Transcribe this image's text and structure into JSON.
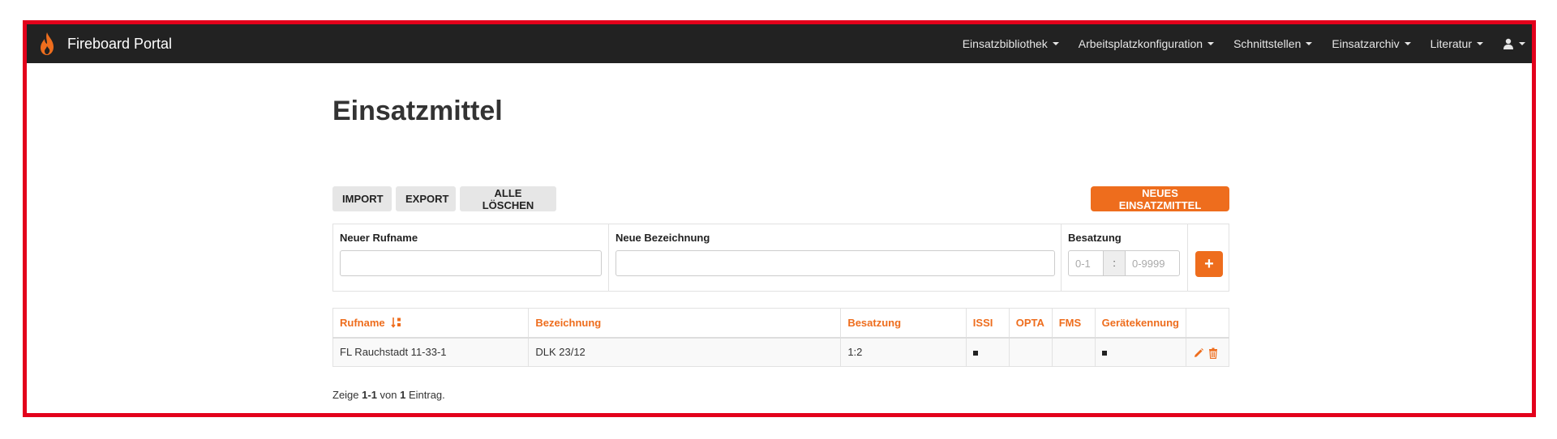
{
  "app": {
    "brand": "Fireboard Portal"
  },
  "nav": {
    "items": [
      {
        "label": "Einsatzbibliothek"
      },
      {
        "label": "Arbeitsplatzkonfiguration"
      },
      {
        "label": "Schnittstellen"
      },
      {
        "label": "Einsatzarchiv"
      },
      {
        "label": "Literatur"
      }
    ]
  },
  "page": {
    "title": "Einsatzmittel"
  },
  "toolbar": {
    "import_label": "IMPORT",
    "export_label": "EXPORT",
    "delete_all_label": "ALLE LÖSCHEN",
    "new_label": "NEUES EINSATZMITTEL"
  },
  "form": {
    "rufname_label": "Neuer Rufname",
    "rufname_value": "",
    "bezeichnung_label": "Neue Bezeichnung",
    "bezeichnung_value": "",
    "besatzung_label": "Besatzung",
    "besatzung_a_placeholder": "0-1",
    "besatzung_separator": ":",
    "besatzung_b_placeholder": "0-9999",
    "add_label": "+"
  },
  "table": {
    "headers": [
      "Rufname",
      "Bezeichnung",
      "Besatzung",
      "ISSI",
      "OPTA",
      "FMS",
      "Gerätekennung"
    ],
    "rows": [
      {
        "rufname": "FL Rauchstadt 11-33-1",
        "bezeichnung": "DLK 23/12",
        "besatzung": "1:2",
        "issi": true,
        "opta": false,
        "fms": false,
        "geraetekennung": true
      }
    ]
  },
  "footer": {
    "prefix": "Zeige ",
    "range": "1-1",
    "middle": " von ",
    "total": "1",
    "suffix": " Eintrag."
  },
  "colors": {
    "accent": "#ee6d1d",
    "navbar": "#222222",
    "frame": "#e3001b"
  }
}
